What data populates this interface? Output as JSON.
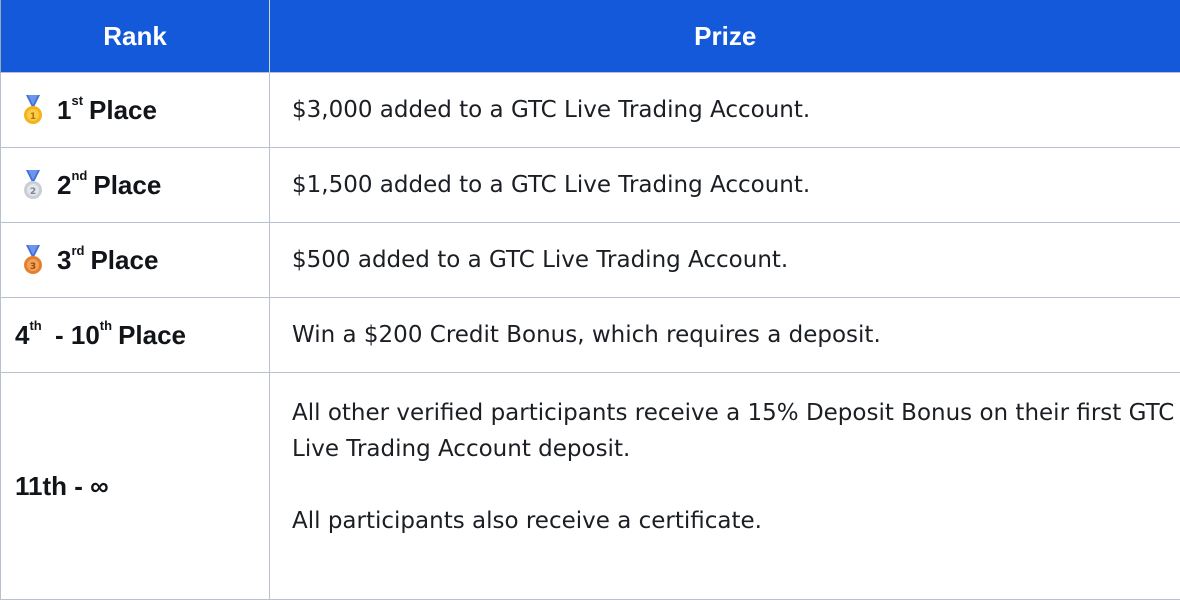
{
  "header": {
    "rank_label": "Rank",
    "prize_label": "Prize"
  },
  "colors": {
    "header_bg": "#1459d9",
    "header_text": "#ffffff",
    "gold": "#f4b21b",
    "silver": "#c9ced6",
    "bronze": "#e57f2e",
    "ribbon_blue": "#3f6fd8"
  },
  "rows": [
    {
      "medal_icon": "gold-medal-icon",
      "rank_number": "1",
      "rank_suffix": "st",
      "rank_text": "Place",
      "prize": "$3,000 added to a GTC Live Trading Account."
    },
    {
      "medal_icon": "silver-medal-icon",
      "rank_number": "2",
      "rank_suffix": "nd",
      "rank_text": "Place",
      "prize": "$1,500 added to a GTC Live Trading Account."
    },
    {
      "medal_icon": "bronze-medal-icon",
      "rank_number": "3",
      "rank_suffix": "rd",
      "rank_text": "Place",
      "prize": "$500 added to a GTC Live Trading Account."
    },
    {
      "rank_from": "4",
      "rank_from_suffix": "th",
      "rank_sep": "- 10",
      "rank_to_suffix": "th",
      "rank_text": "Place",
      "prize": "Win a $200 Credit Bonus, which requires a deposit."
    },
    {
      "rank": "11th - ∞",
      "prize_lines": [
        "All other verified participants receive a 15% Deposit Bonus on their first GTC Live Trading Account deposit.",
        "All participants also receive a certificate."
      ]
    }
  ]
}
